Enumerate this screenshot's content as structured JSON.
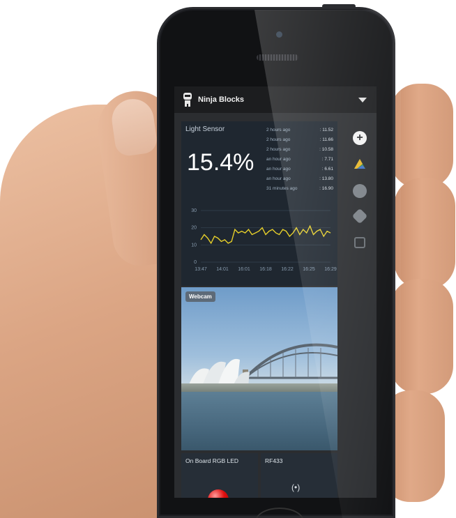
{
  "app": {
    "brand": "Ninja Blocks",
    "icons": {
      "logo": "ninja-robot-icon",
      "menu": "chevron-down-icon"
    }
  },
  "light_sensor": {
    "title": "Light Sensor",
    "value": "15.4%",
    "history": [
      {
        "time": "2 hours ago",
        "value": ": 11.52"
      },
      {
        "time": "2 hours ago",
        "value": ": 11.66"
      },
      {
        "time": "2 hours ago",
        "value": ": 10.58"
      },
      {
        "time": "an hour ago",
        "value": ": 7.71"
      },
      {
        "time": "an hour ago",
        "value": ": 6.61"
      },
      {
        "time": "an hour ago",
        "value": ": 13.80"
      },
      {
        "time": "31 minutes ago",
        "value": ": 16.90"
      }
    ]
  },
  "chart_data": {
    "type": "line",
    "title": "",
    "xlabel": "",
    "ylabel": "",
    "ylim": [
      0,
      30
    ],
    "y_ticks": [
      "30",
      "20",
      "10",
      "0"
    ],
    "x_ticks": [
      "13:47",
      "14:01",
      "16:01",
      "16:18",
      "16:22",
      "16:25",
      "16:29"
    ],
    "grid": true,
    "color": "#e6cf2a",
    "series": [
      {
        "values": [
          13,
          16,
          14,
          11,
          15,
          14,
          12,
          13,
          11,
          12,
          19,
          17,
          18,
          17,
          19,
          16,
          17,
          18,
          20,
          16,
          18,
          19,
          17,
          16,
          19,
          18,
          15,
          17,
          20,
          16,
          19,
          17,
          21,
          16,
          18,
          19,
          15,
          18,
          17
        ]
      }
    ]
  },
  "sidebar": {
    "icons": [
      "plus-icon",
      "google-drive-icon",
      "smiley-icon",
      "dropbox-icon",
      "network-icon"
    ],
    "plus_label": "+"
  },
  "webcam": {
    "label": "Webcam"
  },
  "led": {
    "title": "On Board RGB LED",
    "color": "#e01010"
  },
  "rf433": {
    "title": "RF433",
    "icon_glyph": "(•)"
  }
}
